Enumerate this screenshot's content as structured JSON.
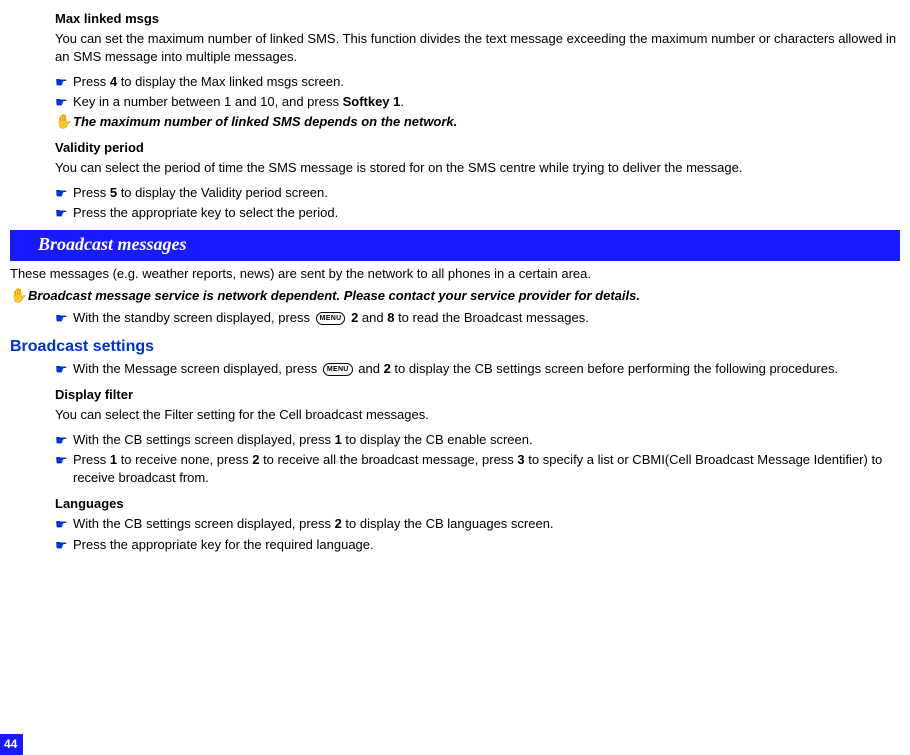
{
  "maxLinked": {
    "title": "Max linked msgs",
    "desc": "You can set the maximum number of linked SMS. This function divides the text message exceeding the maximum number or characters allowed in an SMS message into multiple messages.",
    "step1_pre": "Press ",
    "step1_key": "4",
    "step1_post": " to display the Max linked msgs screen.",
    "step2_pre": "Key in a number between 1 and 10, and press ",
    "step2_key": "Softkey 1",
    "step2_post": ".",
    "note": "The maximum number of linked SMS depends on the network."
  },
  "validity": {
    "title": "Validity period",
    "desc": "You can select the period of time the SMS message is stored for on the SMS centre while trying to deliver the message.",
    "step1_pre": "Press ",
    "step1_key": "5",
    "step1_post": " to display the Validity period screen.",
    "step2": "Press the appropriate key to select the period."
  },
  "broadcastBar": "Broadcast messages",
  "broadcastIntro": "These messages (e.g. weather reports, news) are sent by the network to all phones in a certain area.",
  "broadcastNote": "Broadcast message service is network dependent. Please contact your service provider for details.",
  "broadcastStep_pre": "With the standby screen displayed, press ",
  "broadcastStep_menu": "MENU",
  "broadcastStep_mid1": " ",
  "broadcastStep_k1": "2",
  "broadcastStep_mid2": " and ",
  "broadcastStep_k2": "8",
  "broadcastStep_post": " to read the Broadcast messages.",
  "broadcastSettings": {
    "heading": "Broadcast settings",
    "step_pre": "With the Message screen displayed, press ",
    "step_menu": "MENU",
    "step_mid": " and ",
    "step_k": "2",
    "step_post": " to display the CB settings screen before performing the following procedures."
  },
  "displayFilter": {
    "title": "Display filter",
    "desc": "You can select the Filter setting for the Cell broadcast messages.",
    "step1_pre": "With the CB settings screen displayed, press ",
    "step1_key": "1",
    "step1_post": " to display the CB enable screen.",
    "step2_p1": "Press ",
    "step2_k1": "1",
    "step2_p2": " to receive none, press ",
    "step2_k2": "2",
    "step2_p3": " to receive all the broadcast message, press ",
    "step2_k3": "3",
    "step2_p4": " to specify a list or CBMI(Cell Broadcast Message Identifier) to receive broadcast from."
  },
  "languages": {
    "title": "Languages",
    "step1_pre": "With the CB settings screen displayed, press ",
    "step1_key": "2",
    "step1_post": " to display the CB languages screen.",
    "step2": "Press the appropriate key for the required language."
  },
  "pageNumber": "44"
}
